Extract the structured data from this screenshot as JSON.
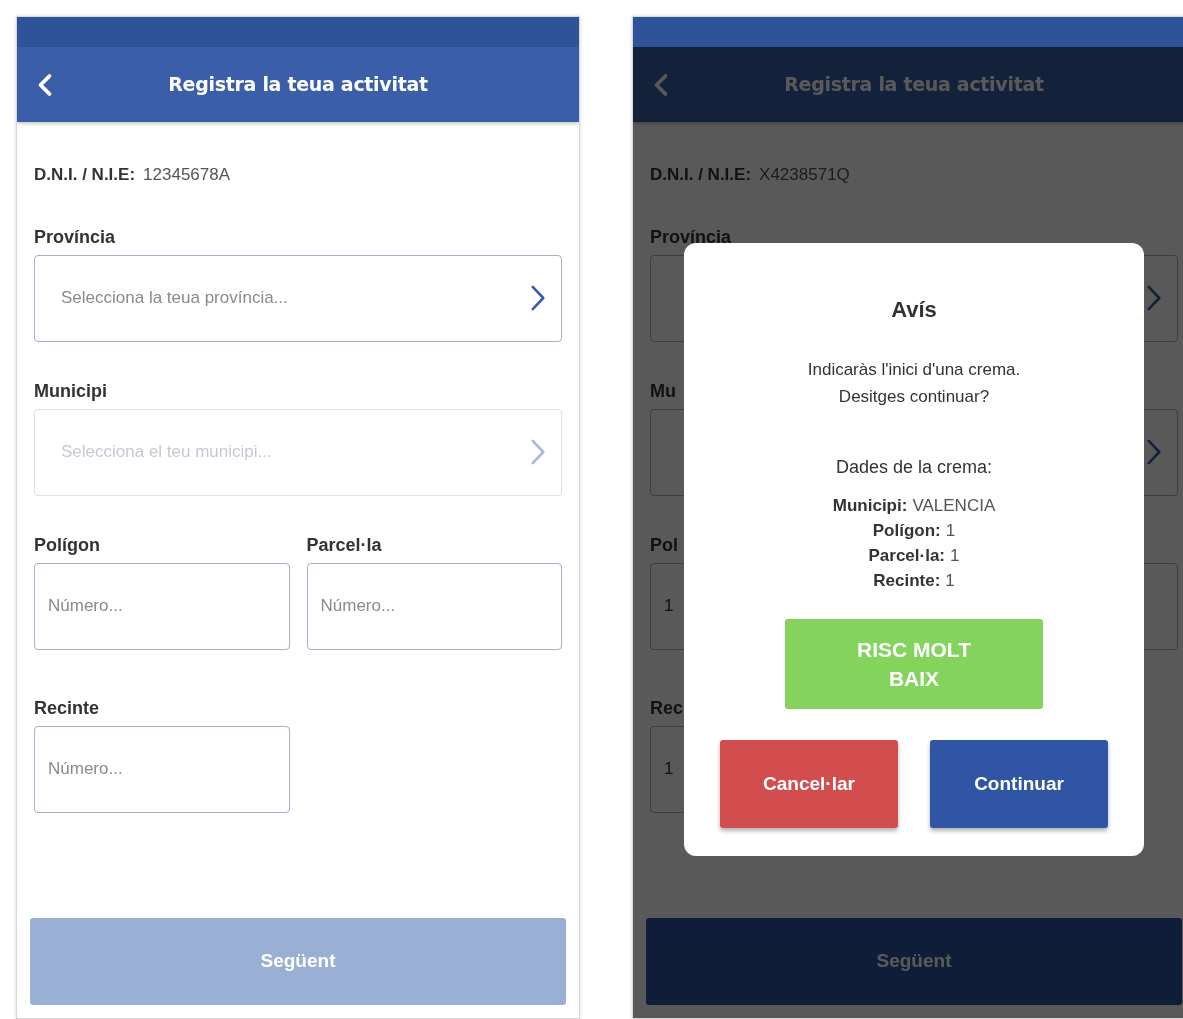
{
  "screens": [
    {
      "title": "Registra la teua activitat",
      "dni_label": "D.N.I. / N.I.E:",
      "dni_value": "12345678A",
      "rows": [
        [
          {
            "kind": "select",
            "label": "Província",
            "placeholder": "Selecciona la teua província...",
            "disabled": false
          }
        ],
        [
          {
            "kind": "select",
            "label": "Municipi",
            "placeholder": "Selecciona el teu municipi...",
            "disabled": true
          }
        ],
        [
          {
            "kind": "number",
            "label": "Polígon",
            "placeholder": "Número...",
            "disabled": false
          },
          {
            "kind": "number",
            "label": "Parcel·la",
            "placeholder": "Número...",
            "disabled": false
          }
        ],
        [
          {
            "kind": "number",
            "label": "Recinte",
            "placeholder": "Número...",
            "disabled": false
          }
        ]
      ],
      "next_button": {
        "label": "Següent",
        "disabled": true
      }
    },
    {
      "title": "Registra la teua activitat",
      "dni_label": "D.N.I. / N.I.E:",
      "dni_value": "X4238571Q",
      "rows": [
        [
          {
            "kind": "select",
            "label": "Província",
            "disabled": false
          }
        ],
        [
          {
            "kind": "select",
            "label": "Mu",
            "disabled": false
          }
        ],
        [
          {
            "kind": "number",
            "label": "Pol",
            "value": "1",
            "disabled": false
          },
          {
            "kind": "number",
            "disabled": false
          }
        ],
        [
          {
            "kind": "number",
            "label": "Rec",
            "value": "1",
            "disabled": false
          }
        ]
      ],
      "next_button": {
        "label": "Següent",
        "disabled": false
      },
      "dialog": {
        "title": "Avís",
        "message": [
          "Indicaràs l'inici d'una crema.",
          "Desitges continuar?"
        ],
        "details_heading": "Dades de la crema:",
        "details": [
          {
            "label": "Municipi:",
            "value": "VALENCIA"
          },
          {
            "label": "Polígon:",
            "value": "1"
          },
          {
            "label": "Parcel·la:",
            "value": "1"
          },
          {
            "label": "Recinte:",
            "value": "1"
          }
        ],
        "risk": {
          "label": "RISC MOLT BAIX",
          "color": "#83d35c"
        },
        "buttons": [
          {
            "kind": "cancel",
            "label": "Cancel·lar"
          },
          {
            "kind": "confirm",
            "label": "Continuar"
          }
        ]
      }
    }
  ]
}
